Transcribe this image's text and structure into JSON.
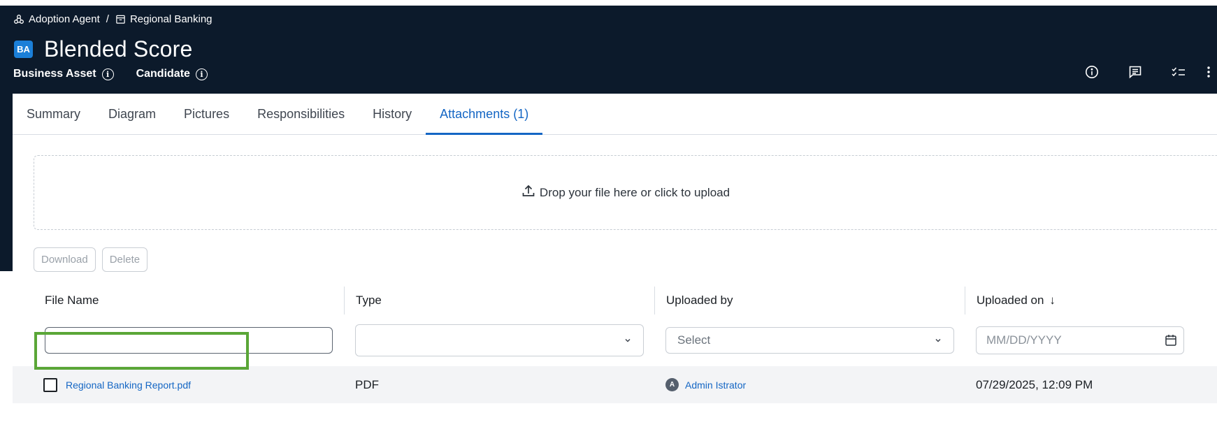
{
  "breadcrumb": {
    "parent": "Adoption Agent",
    "separator": "/",
    "current": "Regional Banking"
  },
  "asset": {
    "badge": "BA",
    "title": "Blended Score",
    "type": "Business Asset",
    "status": "Candidate"
  },
  "header_icons": [
    "info-icon",
    "comment-icon",
    "checklist-icon",
    "more-vertical-icon"
  ],
  "tabs": [
    {
      "label": "Summary",
      "active": false
    },
    {
      "label": "Diagram",
      "active": false
    },
    {
      "label": "Pictures",
      "active": false
    },
    {
      "label": "Responsibilities",
      "active": false
    },
    {
      "label": "History",
      "active": false
    },
    {
      "label": "Attachments (1)",
      "active": true
    }
  ],
  "upload": {
    "text": "Drop your file here or click to upload"
  },
  "actions": {
    "download": "Download",
    "delete": "Delete"
  },
  "table": {
    "columns": [
      "File Name",
      "Type",
      "Uploaded by",
      "Uploaded on"
    ],
    "sort": {
      "column": "Uploaded on",
      "direction": "descending"
    },
    "filters": {
      "file_name": "",
      "type": "",
      "uploaded_by_placeholder": "Select",
      "uploaded_on_placeholder": "MM/DD/YYYY"
    },
    "rows": [
      {
        "file_name": "Regional Banking Report.pdf",
        "type": "PDF",
        "uploaded_by": "Admin Istrator",
        "avatar_initial": "A",
        "uploaded_on": "07/29/2025, 12:09 PM",
        "checked": false
      }
    ]
  },
  "colors": {
    "header_bg": "#0c1a2b",
    "accent": "#1466c4",
    "badge": "#1b7fd8",
    "highlight": "#5aa637"
  }
}
